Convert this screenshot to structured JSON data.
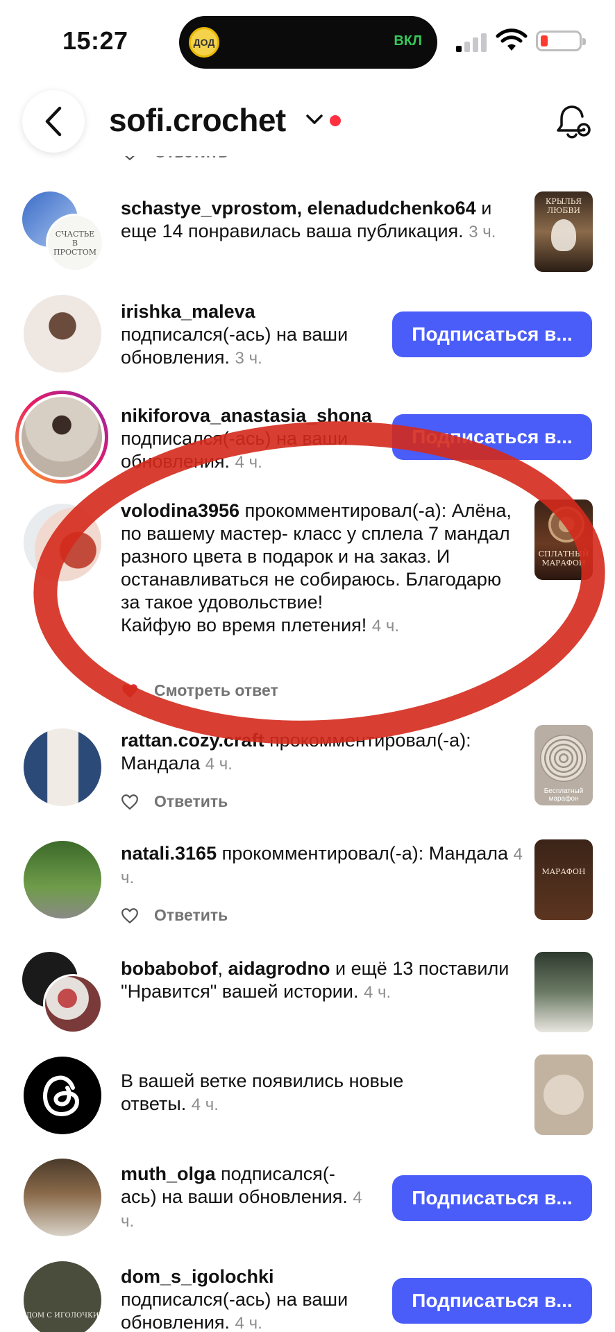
{
  "status_bar": {
    "time": "15:27",
    "island_label": "ДОД",
    "island_status": "ВКЛ"
  },
  "header": {
    "title": "sofi.crochet"
  },
  "notifications": [
    {
      "top_reply_label": "Ответить"
    },
    {
      "users": "schastye_vprostom, elenadudchenko64",
      "text": " и еще 14 понравилась ваша публикация.",
      "ago": "3 ч.",
      "avatar_text": "СЧАСТЬЕ В ПРОСТОМ",
      "thumb_text": "КРЫЛЬЯ ЛЮБВИ"
    },
    {
      "users": "irishka_maleva",
      "text": "подписался(-ась) на ваши обновления.",
      "ago": "3 ч.",
      "button": "Подписаться в..."
    },
    {
      "users": "nikiforova_anastasia_shona",
      "text": " подписался(-ась) на ваши обновления.",
      "ago": "4 ч.",
      "button": "Подписаться в..."
    },
    {
      "users": "volodina3956",
      "text": " прокомментировал(-а): Алёна, по вашему мастер- класс у сплела 7 мандал разного цвета в подарок и на заказ. И останавливаться не собираюсь.  Благодарю за такое удовольствие!",
      "text2": " Кайфую во время плетения!",
      "ago": "4 ч.",
      "reply": "Смотреть ответ",
      "thumb_text": "СПЛАТНЫЙ МАРАФОН"
    },
    {
      "users": "rattan.cozy.craft",
      "text": " прокомментировал(-а): Мандала",
      "ago": "4 ч.",
      "reply": "Ответить",
      "thumb_text": "Бесплатный марафон"
    },
    {
      "users": "natali.3165",
      "text": " прокомментировал(-а): Мандала",
      "ago": "4 ч.",
      "reply": "Ответить",
      "thumb_text": "МАРАФОН"
    },
    {
      "users_a": "bobabobof",
      "users_sep": ", ",
      "users_b": "aidagrodno",
      "text": " и ещё 13 поставили \"Нравится\" вашей истории.",
      "ago": "4 ч."
    },
    {
      "text": "В вашей ветке появились новые ответы.",
      "ago": "4 ч."
    },
    {
      "users": "muth_olga",
      "text": " подписался(-ась) на ваши обновления.",
      "ago": "4 ч.",
      "button": "Подписаться в..."
    },
    {
      "users": "dom_s_igolochki",
      "text": "подписался(-ась) на ваши обновления.",
      "ago": "4 ч.",
      "button": "Подписаться в...",
      "avatar_text": "ДОМ С ИГОЛОЧКИ"
    }
  ],
  "colors": {
    "accent_button": "#4a5df9",
    "annotation_red": "#d42a1c",
    "heart_red": "#e02a35"
  }
}
